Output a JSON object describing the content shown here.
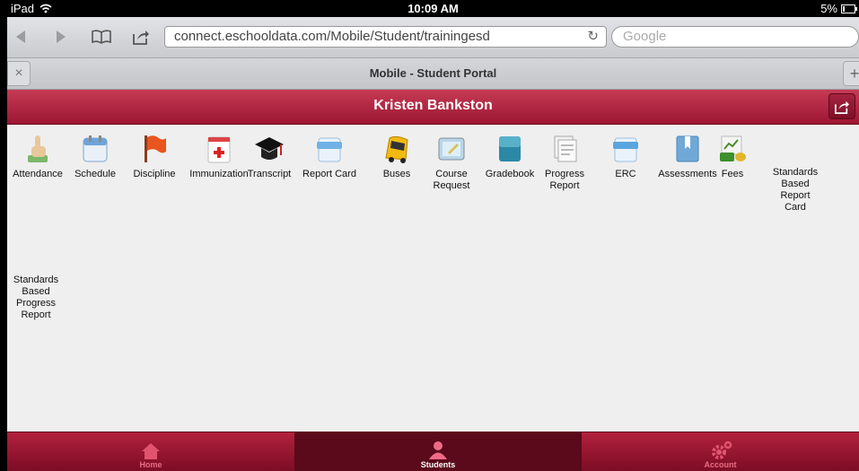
{
  "status": {
    "device": "iPad",
    "time": "10:09 AM",
    "battery": "5%"
  },
  "browser": {
    "url": "connect.eschooldata.com/Mobile/Student/trainingesd",
    "search_placeholder": "Google",
    "tab_title": "Mobile - Student Portal"
  },
  "header": {
    "title": "Kristen Bankston"
  },
  "tiles": [
    {
      "label": "Attendance",
      "icon": "attendance-icon"
    },
    {
      "label": "Schedule",
      "icon": "calendar-icon"
    },
    {
      "label": "Discipline",
      "icon": "flag-icon"
    },
    {
      "label": "Immunization",
      "icon": "medical-icon"
    },
    {
      "label": "Transcript",
      "icon": "graduation-cap-icon"
    },
    {
      "label": "Report Card",
      "icon": "card-icon"
    },
    {
      "label": "Buses",
      "icon": "bus-icon"
    },
    {
      "label": "Course Request",
      "icon": "request-icon"
    },
    {
      "label": "Gradebook",
      "icon": "book-icon"
    },
    {
      "label": "Progress Report",
      "icon": "report-icon"
    },
    {
      "label": "ERC",
      "icon": "erc-icon"
    },
    {
      "label": "Assessments",
      "icon": "bookmark-icon"
    },
    {
      "label": "Fees",
      "icon": "money-icon"
    },
    {
      "label": "Standards Based Report Card",
      "icon": "standards-icon"
    },
    {
      "label": "Standards Based Progress Report",
      "icon": "standards-progress-icon"
    }
  ],
  "bottom_tabs": [
    {
      "label": "Home",
      "icon": "home-icon"
    },
    {
      "label": "Students",
      "icon": "person-icon"
    },
    {
      "label": "Account",
      "icon": "gear-icon"
    }
  ],
  "colors": {
    "brand": "#a81d3a",
    "brand_dark": "#7a0d24",
    "page_bg": "#efefef"
  }
}
